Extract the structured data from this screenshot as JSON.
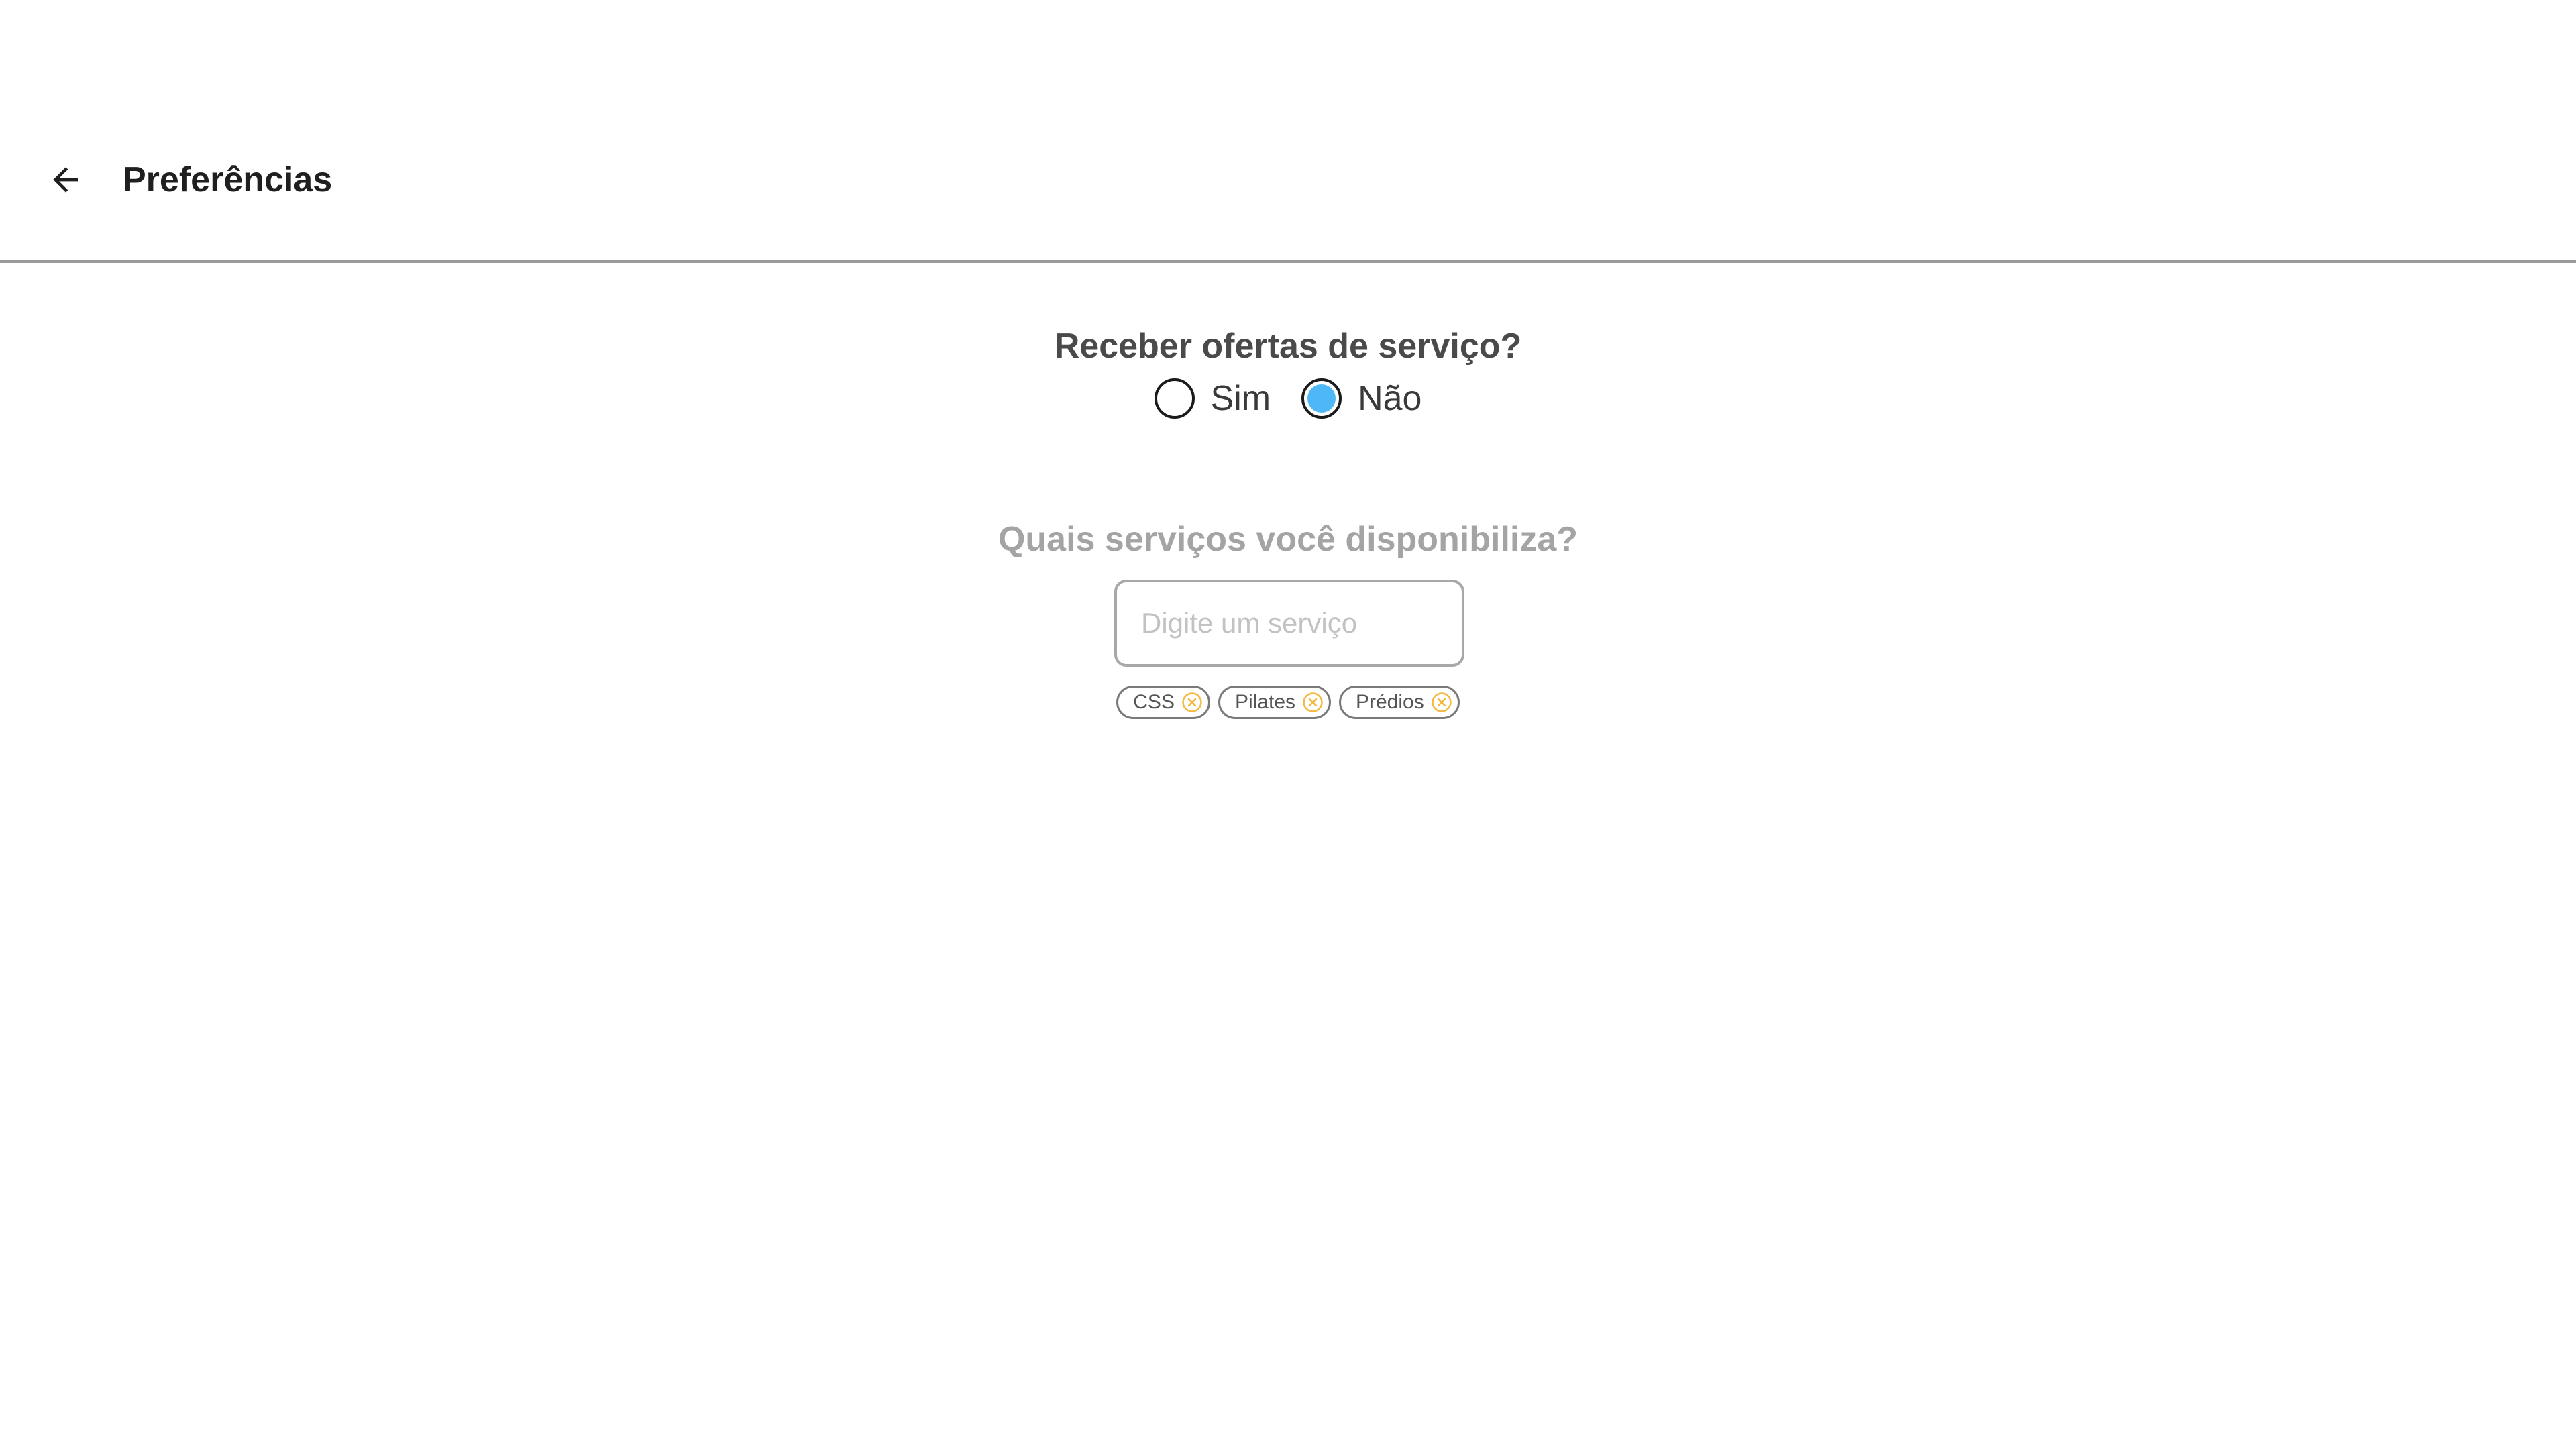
{
  "header": {
    "title": "Preferências",
    "back_icon": "arrow-left-icon"
  },
  "offers": {
    "question": "Receber ofertas de serviço?",
    "options": [
      {
        "label": "Sim",
        "checked": false
      },
      {
        "label": "Não",
        "checked": true
      }
    ],
    "selected_color": "#4db8f5"
  },
  "services": {
    "question": "Quais serviços você disponibiliza?",
    "input_placeholder": "Digite um serviço",
    "input_value": "",
    "tags": [
      {
        "label": "CSS"
      },
      {
        "label": "Pilates"
      },
      {
        "label": "Prédios"
      }
    ],
    "remove_icon": "close-circle-icon",
    "remove_icon_color": "#f5b942"
  }
}
